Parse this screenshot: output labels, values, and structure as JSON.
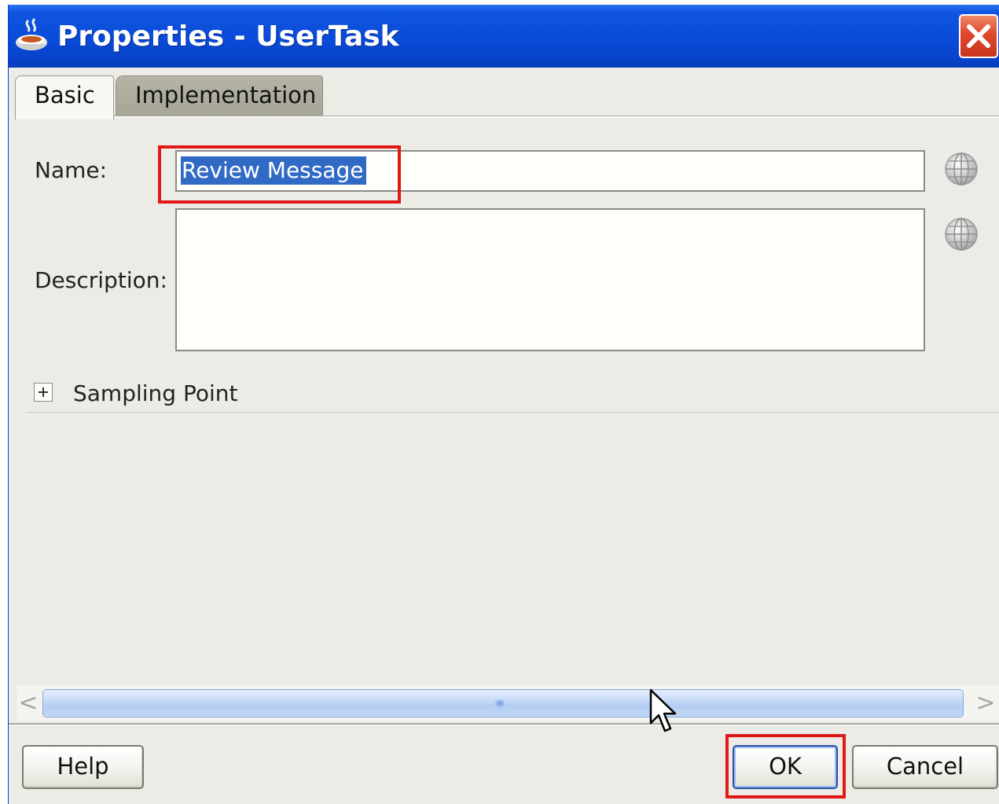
{
  "window": {
    "title": "Properties - UserTask"
  },
  "tabs": [
    {
      "label": "Basic",
      "active": true
    },
    {
      "label": "Implementation",
      "active": false
    }
  ],
  "form": {
    "name_label": "Name:",
    "name_value": "Review Message",
    "description_label": "Description:",
    "description_value": ""
  },
  "sampling_point": {
    "label": "Sampling Point",
    "expanded": false
  },
  "buttons": {
    "help": "Help",
    "ok": "OK",
    "cancel": "Cancel"
  },
  "scrollbar": {
    "left_arrow": "<",
    "right_arrow": ">"
  },
  "colors": {
    "title_bar": "#0a4cd9",
    "highlight": "#e01818",
    "selection": "#316ac5",
    "background": "#ecebe6"
  },
  "icons": [
    "app-icon",
    "close-icon",
    "translate-globe-icon",
    "expand-plus-icon",
    "mouse-pointer-icon"
  ]
}
